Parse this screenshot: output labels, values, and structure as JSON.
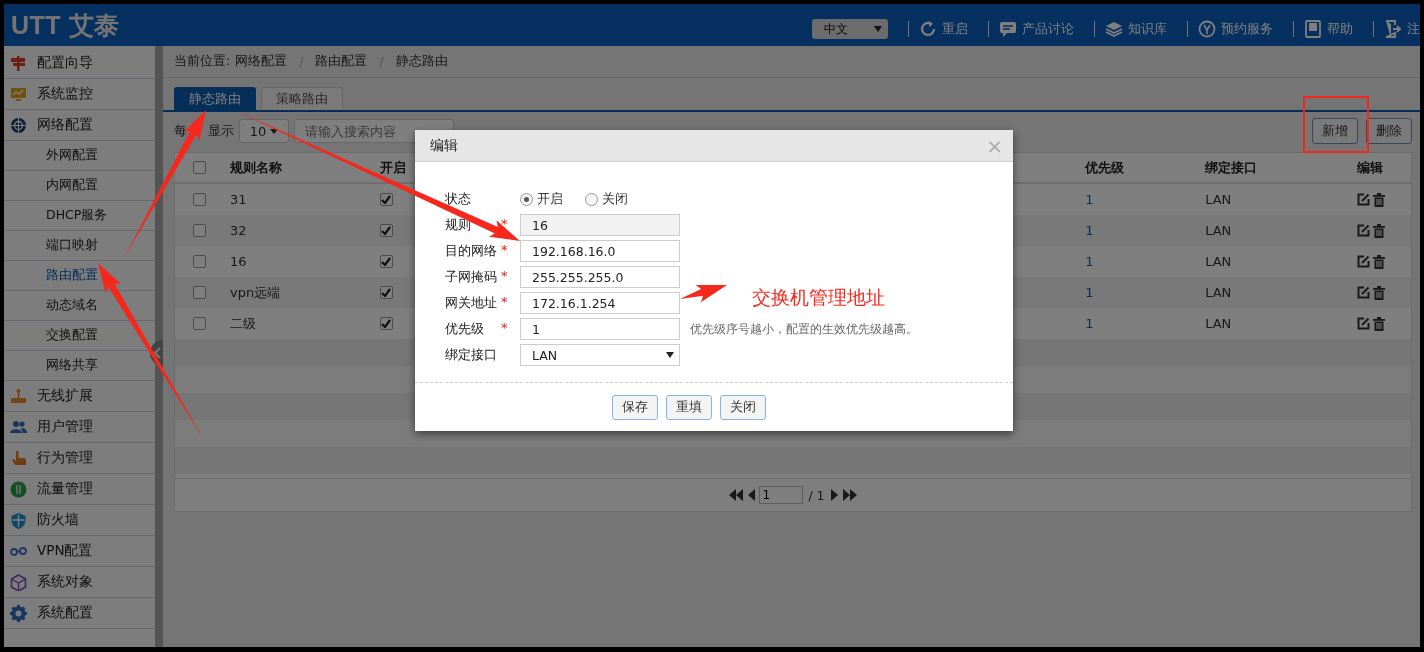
{
  "header": {
    "logo": "UTT 艾泰",
    "language": "中文",
    "links": [
      {
        "label": "重启"
      },
      {
        "label": "产品讨论"
      },
      {
        "label": "知识库"
      },
      {
        "label": "预约服务"
      },
      {
        "label": "帮助"
      },
      {
        "label": "注"
      }
    ]
  },
  "sidebar": {
    "items": [
      {
        "label": "配置向导",
        "selected": false
      },
      {
        "label": "系统监控",
        "selected": false
      },
      {
        "label": "网络配置",
        "selected": false,
        "children": [
          {
            "label": "外网配置",
            "selected": false
          },
          {
            "label": "内网配置",
            "selected": false
          },
          {
            "label": "DHCP服务",
            "selected": false
          },
          {
            "label": "端口映射",
            "selected": false
          },
          {
            "label": "路由配置",
            "selected": true
          },
          {
            "label": "动态域名",
            "selected": false
          },
          {
            "label": "交换配置",
            "selected": false
          },
          {
            "label": "网络共享",
            "selected": false
          }
        ]
      },
      {
        "label": "无线扩展",
        "selected": false
      },
      {
        "label": "用户管理",
        "selected": false
      },
      {
        "label": "行为管理",
        "selected": false
      },
      {
        "label": "流量管理",
        "selected": false
      },
      {
        "label": "防火墙",
        "selected": false
      },
      {
        "label": "VPN配置",
        "selected": false
      },
      {
        "label": "系统对象",
        "selected": false
      },
      {
        "label": "系统配置",
        "selected": false
      }
    ]
  },
  "breadcrumb": {
    "label": "当前位置:",
    "separator": "/",
    "items": [
      "网络配置",
      "路由配置",
      "静态路由"
    ]
  },
  "tabs": [
    {
      "label": "静态路由",
      "selected": true
    },
    {
      "label": "策略路由",
      "selected": false
    }
  ],
  "toolbar": {
    "page_size_label": [
      "每",
      "显示"
    ],
    "page_size": "10",
    "search": {
      "placeholder": "请输入搜索内容"
    },
    "buttons": [
      "新增",
      "删除"
    ]
  },
  "table": {
    "select_all": {
      "checked": false
    },
    "columns": [
      "规则名称",
      "开启",
      "优先级",
      "绑定接口",
      "编辑"
    ],
    "rows": [
      {
        "checked": false,
        "name": "31",
        "enabled": true,
        "priority": "1",
        "interface": "LAN"
      },
      {
        "checked": false,
        "name": "32",
        "enabled": true,
        "priority": "1",
        "interface": "LAN"
      },
      {
        "checked": false,
        "name": "16",
        "enabled": true,
        "priority": "1",
        "interface": "LAN"
      },
      {
        "checked": false,
        "name": "vpn远端",
        "enabled": true,
        "priority": "1",
        "interface": "LAN"
      },
      {
        "checked": false,
        "name": "二级",
        "enabled": true,
        "priority": "1",
        "interface": "LAN"
      }
    ]
  },
  "pagination": {
    "page": "1",
    "total": "/ 1"
  },
  "dialog": {
    "title": "编辑",
    "close": "×",
    "fields": [
      {
        "kind": "radio",
        "label": "状态",
        "options": [
          {
            "label": "开启",
            "selected": true
          },
          {
            "label": "关闭",
            "selected": false
          }
        ]
      },
      {
        "kind": "text",
        "label": "规则",
        "required_mark": "*",
        "value": "16",
        "disabled": true
      },
      {
        "kind": "text",
        "label": "目的网络",
        "required_mark": "*",
        "value": "192.168.16.0",
        "disabled": false
      },
      {
        "kind": "text",
        "label": "子网掩码",
        "required_mark": "*",
        "value": "255.255.255.0",
        "disabled": false
      },
      {
        "kind": "text",
        "label": "网关地址",
        "required_mark": "*",
        "value": "172.16.1.254",
        "disabled": false
      },
      {
        "kind": "text",
        "label": "优先级",
        "required_mark": "*",
        "value": "1",
        "disabled": false,
        "hint": "优先级序号越小，配置的生效优先级越高。"
      },
      {
        "kind": "select",
        "label": "绑定接口",
        "value": "LAN"
      }
    ],
    "buttons": [
      "保存",
      "重填",
      "关闭"
    ]
  },
  "annotation": {
    "text": "交换机管理地址"
  }
}
